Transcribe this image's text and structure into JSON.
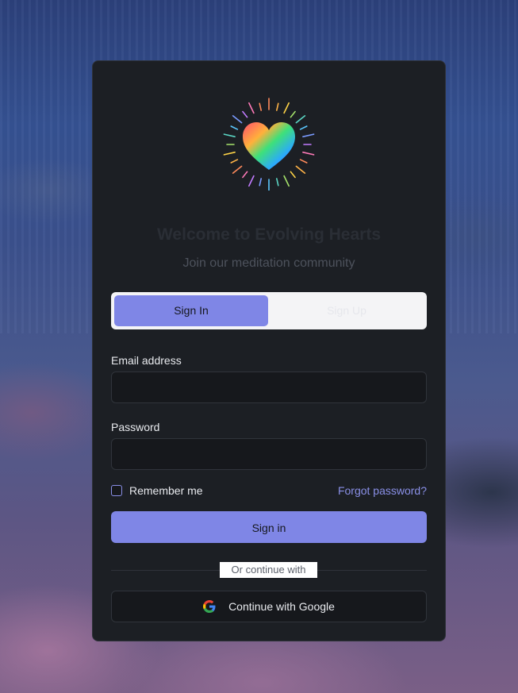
{
  "background": {
    "description_icon": "waterfall-background-image"
  },
  "brand": {
    "logo_icon": "rainbow-heart-icon",
    "title": "Welcome to Evolving Hearts",
    "subtitle": "Join our meditation community"
  },
  "tabs": [
    {
      "label": "Sign In",
      "active": true
    },
    {
      "label": "Sign Up",
      "active": false
    }
  ],
  "form": {
    "email_label": "Email address",
    "email_value": "",
    "email_placeholder": "",
    "password_label": "Password",
    "password_value": "",
    "password_placeholder": "",
    "remember_label": "Remember me",
    "remember_checked": false,
    "forgot_label": "Forgot password?",
    "submit_label": "Sign in"
  },
  "divider": {
    "text": "Or continue with"
  },
  "google": {
    "label": "Continue with Google",
    "icon": "google-icon"
  },
  "colors": {
    "accent": "#7f86e6",
    "card_bg": "#1c1f24",
    "input_bg": "#16181c",
    "link": "#8a90e8"
  }
}
